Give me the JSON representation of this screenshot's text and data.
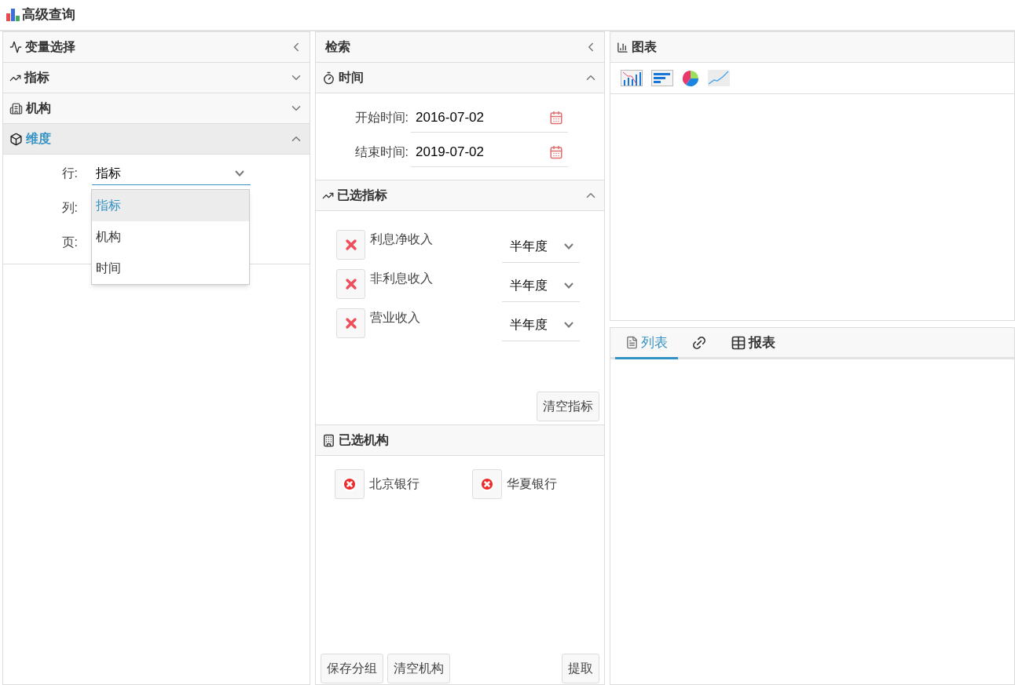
{
  "title": "高级查询",
  "variables": {
    "title": "变量选择",
    "sections": [
      {
        "label": "指标",
        "kind": "indicator",
        "expanded": false
      },
      {
        "label": "机构",
        "kind": "org",
        "expanded": false
      },
      {
        "label": "维度",
        "kind": "dimension",
        "expanded": true
      }
    ],
    "dimension": {
      "rows": [
        {
          "label": "行:",
          "value": "指标"
        },
        {
          "label": "列:"
        },
        {
          "label": "页:"
        }
      ],
      "options": [
        {
          "label": "指标",
          "selected": true
        },
        {
          "label": "机构",
          "selected": false
        },
        {
          "label": "时间",
          "selected": false
        }
      ]
    }
  },
  "search": {
    "title": "检索",
    "time": {
      "title": "时间",
      "expanded": true,
      "fields": [
        {
          "label": "开始时间:",
          "value": "2016-07-02"
        },
        {
          "label": "结束时间:",
          "value": "2019-07-02"
        }
      ]
    },
    "indicators": {
      "title": "已选指标",
      "expanded": true,
      "items": [
        {
          "name": "利息净收入",
          "period": "半年度"
        },
        {
          "name": "非利息收入",
          "period": "半年度"
        },
        {
          "name": "营业收入",
          "period": "半年度"
        }
      ],
      "clear_button": "清空指标"
    },
    "orgs": {
      "title": "已选机构",
      "items": [
        "北京银行",
        "华夏银行"
      ]
    },
    "buttons": [
      {
        "label": "保存分组"
      },
      {
        "label": "清空机构"
      },
      {
        "label": "提取"
      }
    ]
  },
  "chart": {
    "title": "图表",
    "types": [
      {
        "kind": "bar"
      },
      {
        "kind": "hbar"
      },
      {
        "kind": "pie"
      },
      {
        "kind": "line"
      }
    ]
  },
  "tabs": [
    {
      "kind": "list",
      "label": "列表",
      "selected": true
    },
    {
      "kind": "link",
      "selected": false
    },
    {
      "kind": "table",
      "label": "报表",
      "selected": false
    }
  ]
}
